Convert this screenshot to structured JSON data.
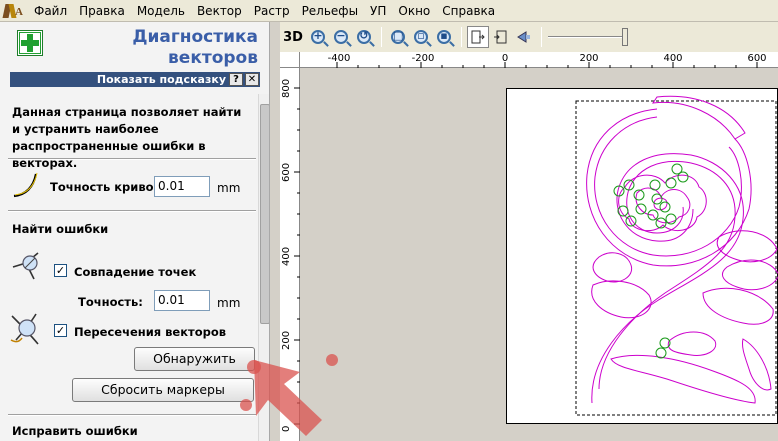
{
  "menu": {
    "items": [
      "Файл",
      "Правка",
      "Модель",
      "Вектор",
      "Растр",
      "Рельефы",
      "УП",
      "Окно",
      "Справка"
    ]
  },
  "panel": {
    "title_line1": "Диагностика",
    "title_line2": "векторов",
    "hint_label": "Показать подсказку",
    "hint_help": "?",
    "hint_close": "✕",
    "description": "Данная страница позволяет найти и устранить наиболее распространенные ошибки в векторах.",
    "curve_accuracy_label": "Точность кривой",
    "curve_accuracy_value": "0.01",
    "unit_mm": "mm",
    "find_errors_heading": "Найти ошибки",
    "coincident_points_label": "Совпадение точек",
    "coincident_points_checked": "✓",
    "tolerance_label": "Точность:",
    "tolerance_value": "0.01",
    "intersections_label": "Пересечения векторов",
    "intersections_checked": "✓",
    "detect_button": "Обнаружить",
    "reset_markers_button": "Сбросить маркеры",
    "fix_errors_heading": "Исправить ошибки"
  },
  "toolbar": {
    "view_3d_label": "3D"
  },
  "ruler": {
    "h_ticks": [
      "-400",
      "-200",
      "0",
      "200",
      "400",
      "600"
    ],
    "v_ticks": [
      "800",
      "600",
      "400",
      "200",
      "0"
    ]
  },
  "colors": {
    "vector": "#cc00cc",
    "marker": "#1a9a1a",
    "panel_title": "#3a5ea8",
    "hint_bar": "#34517e",
    "annotation_arrow": "#d9534f"
  }
}
